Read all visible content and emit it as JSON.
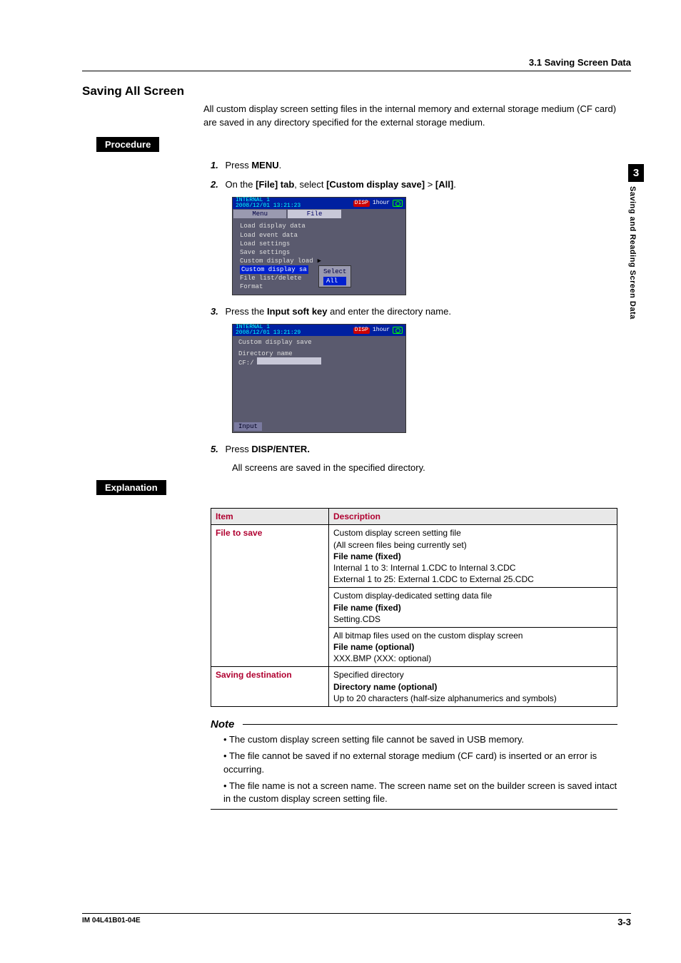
{
  "header": {
    "section_ref": "3.1 Saving Screen Data"
  },
  "title": "Saving All Screen",
  "intro": "All custom display screen setting files in the internal memory and external storage medium (CF card) are saved in any directory specified for the external storage medium.",
  "labels": {
    "procedure": "Procedure",
    "explanation": "Explanation"
  },
  "steps": {
    "s1": {
      "num": "1.",
      "pre": "Press ",
      "b": "MENU",
      "post": "."
    },
    "s2": {
      "num": "2.",
      "pre": "On the ",
      "b1": "[File] tab",
      "mid": ", select ",
      "b2": "[Custom display save]",
      "gt": " > ",
      "b3": "[All]",
      "post": "."
    },
    "s3": {
      "num": "3.",
      "pre": "Press the ",
      "b": "Input soft key",
      "post": " and enter the directory name."
    },
    "s5": {
      "num": "5.",
      "pre": "Press ",
      "b": "DISP/ENTER."
    },
    "s5b": "All screens are saved in the specified directory."
  },
  "ss1": {
    "title_l1": "INTERNAL 1",
    "title_l2": "2008/12/01 13:21:23",
    "disp": "DISP",
    "time": "1hour",
    "tab_menu": "Menu",
    "tab_file": "File",
    "items": {
      "i1": "Load display data",
      "i2": "Load event data",
      "i3": "Load settings",
      "i4": "Save settings",
      "i5": "Custom display load",
      "i6": "Custom display sa",
      "i7": "File list/delete",
      "i8": "Format"
    },
    "sub_select": "Select",
    "sub_all": "All"
  },
  "ss2": {
    "title_l1": "INTERNAL 1",
    "title_l2": "2008/12/01 13:21:29",
    "disp": "DISP",
    "time": "1hour",
    "hdr": "Custom display save",
    "dirlabel": "Directory name",
    "drive": "CF:/",
    "softkey": "Input"
  },
  "table": {
    "h_item": "Item",
    "h_desc": "Description",
    "r1_item": "File to save",
    "r1_d1": "Custom display screen setting file",
    "r1_d2": "(All screen files being currently set)",
    "r1_d3": "File name (fixed)",
    "r1_d4": "Internal 1 to 3: Internal 1.CDC to Internal 3.CDC",
    "r1_d5": "External 1 to 25: External 1.CDC to External 25.CDC",
    "r2_d1": "Custom display-dedicated setting data file",
    "r2_d2": "File name (fixed)",
    "r2_d3": "Setting.CDS",
    "r3_d1": "All bitmap files used on the custom display screen",
    "r3_d2": "File name (optional)",
    "r3_d3": "XXX.BMP (XXX: optional)",
    "r4_item": "Saving destination",
    "r4_d1": "Specified directory",
    "r4_d2": "Directory name (optional)",
    "r4_d3": "Up to 20 characters (half-size alphanumerics and symbols)"
  },
  "note": {
    "title": "Note",
    "n1": "The custom display screen setting file cannot be saved in USB memory.",
    "n2": "The file cannot be saved if no external storage medium (CF card) is inserted or an error is occurring.",
    "n3": "The file name is not a screen name. The screen name set on the builder screen is saved intact in the custom display screen setting file."
  },
  "sidetab": {
    "num": "3",
    "text": "Saving and Reading Screen Data"
  },
  "footer": {
    "left": "IM 04L41B01-04E",
    "right": "3-3"
  }
}
